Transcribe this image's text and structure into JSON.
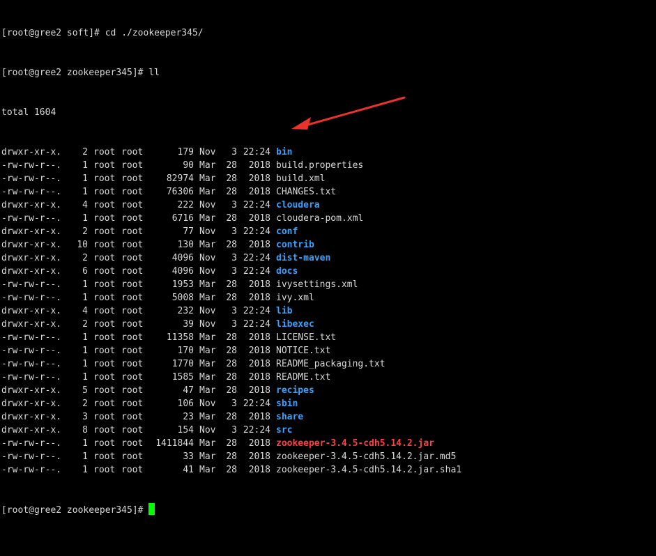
{
  "terminal": {
    "commands": [
      {
        "prompt": "[root@gree2 soft]# ",
        "command": "cd ./zookeeper345/"
      },
      {
        "prompt": "[root@gree2 zookeeper345]# ",
        "command": "ll"
      }
    ],
    "total": "total 1604",
    "entries": [
      {
        "perm": "drwxr-xr-x.",
        "links": "2",
        "owner": "root",
        "group": "root",
        "size": "179",
        "month": "Nov",
        "day": "3",
        "time": "22:24",
        "name": "bin",
        "kind": "dir"
      },
      {
        "perm": "-rw-rw-r--.",
        "links": "1",
        "owner": "root",
        "group": "root",
        "size": "90",
        "month": "Mar",
        "day": "28",
        "time": "2018",
        "name": "build.properties",
        "kind": "file"
      },
      {
        "perm": "-rw-rw-r--.",
        "links": "1",
        "owner": "root",
        "group": "root",
        "size": "82974",
        "month": "Mar",
        "day": "28",
        "time": "2018",
        "name": "build.xml",
        "kind": "file"
      },
      {
        "perm": "-rw-rw-r--.",
        "links": "1",
        "owner": "root",
        "group": "root",
        "size": "76306",
        "month": "Mar",
        "day": "28",
        "time": "2018",
        "name": "CHANGES.txt",
        "kind": "file"
      },
      {
        "perm": "drwxr-xr-x.",
        "links": "4",
        "owner": "root",
        "group": "root",
        "size": "222",
        "month": "Nov",
        "day": "3",
        "time": "22:24",
        "name": "cloudera",
        "kind": "dir"
      },
      {
        "perm": "-rw-rw-r--.",
        "links": "1",
        "owner": "root",
        "group": "root",
        "size": "6716",
        "month": "Mar",
        "day": "28",
        "time": "2018",
        "name": "cloudera-pom.xml",
        "kind": "file"
      },
      {
        "perm": "drwxr-xr-x.",
        "links": "2",
        "owner": "root",
        "group": "root",
        "size": "77",
        "month": "Nov",
        "day": "3",
        "time": "22:24",
        "name": "conf",
        "kind": "dir"
      },
      {
        "perm": "drwxr-xr-x.",
        "links": "10",
        "owner": "root",
        "group": "root",
        "size": "130",
        "month": "Mar",
        "day": "28",
        "time": "2018",
        "name": "contrib",
        "kind": "dir"
      },
      {
        "perm": "drwxr-xr-x.",
        "links": "2",
        "owner": "root",
        "group": "root",
        "size": "4096",
        "month": "Nov",
        "day": "3",
        "time": "22:24",
        "name": "dist-maven",
        "kind": "dir"
      },
      {
        "perm": "drwxr-xr-x.",
        "links": "6",
        "owner": "root",
        "group": "root",
        "size": "4096",
        "month": "Nov",
        "day": "3",
        "time": "22:24",
        "name": "docs",
        "kind": "dir"
      },
      {
        "perm": "-rw-rw-r--.",
        "links": "1",
        "owner": "root",
        "group": "root",
        "size": "1953",
        "month": "Mar",
        "day": "28",
        "time": "2018",
        "name": "ivysettings.xml",
        "kind": "file"
      },
      {
        "perm": "-rw-rw-r--.",
        "links": "1",
        "owner": "root",
        "group": "root",
        "size": "5008",
        "month": "Mar",
        "day": "28",
        "time": "2018",
        "name": "ivy.xml",
        "kind": "file"
      },
      {
        "perm": "drwxr-xr-x.",
        "links": "4",
        "owner": "root",
        "group": "root",
        "size": "232",
        "month": "Nov",
        "day": "3",
        "time": "22:24",
        "name": "lib",
        "kind": "dir"
      },
      {
        "perm": "drwxr-xr-x.",
        "links": "2",
        "owner": "root",
        "group": "root",
        "size": "39",
        "month": "Nov",
        "day": "3",
        "time": "22:24",
        "name": "libexec",
        "kind": "dir"
      },
      {
        "perm": "-rw-rw-r--.",
        "links": "1",
        "owner": "root",
        "group": "root",
        "size": "11358",
        "month": "Mar",
        "day": "28",
        "time": "2018",
        "name": "LICENSE.txt",
        "kind": "file"
      },
      {
        "perm": "-rw-rw-r--.",
        "links": "1",
        "owner": "root",
        "group": "root",
        "size": "170",
        "month": "Mar",
        "day": "28",
        "time": "2018",
        "name": "NOTICE.txt",
        "kind": "file"
      },
      {
        "perm": "-rw-rw-r--.",
        "links": "1",
        "owner": "root",
        "group": "root",
        "size": "1770",
        "month": "Mar",
        "day": "28",
        "time": "2018",
        "name": "README_packaging.txt",
        "kind": "file"
      },
      {
        "perm": "-rw-rw-r--.",
        "links": "1",
        "owner": "root",
        "group": "root",
        "size": "1585",
        "month": "Mar",
        "day": "28",
        "time": "2018",
        "name": "README.txt",
        "kind": "file"
      },
      {
        "perm": "drwxr-xr-x.",
        "links": "5",
        "owner": "root",
        "group": "root",
        "size": "47",
        "month": "Mar",
        "day": "28",
        "time": "2018",
        "name": "recipes",
        "kind": "dir"
      },
      {
        "perm": "drwxr-xr-x.",
        "links": "2",
        "owner": "root",
        "group": "root",
        "size": "106",
        "month": "Nov",
        "day": "3",
        "time": "22:24",
        "name": "sbin",
        "kind": "dir"
      },
      {
        "perm": "drwxr-xr-x.",
        "links": "3",
        "owner": "root",
        "group": "root",
        "size": "23",
        "month": "Mar",
        "day": "28",
        "time": "2018",
        "name": "share",
        "kind": "dir"
      },
      {
        "perm": "drwxr-xr-x.",
        "links": "8",
        "owner": "root",
        "group": "root",
        "size": "154",
        "month": "Nov",
        "day": "3",
        "time": "22:24",
        "name": "src",
        "kind": "dir"
      },
      {
        "perm": "-rw-rw-r--.",
        "links": "1",
        "owner": "root",
        "group": "root",
        "size": "1411844",
        "month": "Mar",
        "day": "28",
        "time": "2018",
        "name": "zookeeper-3.4.5-cdh5.14.2.jar",
        "kind": "jar"
      },
      {
        "perm": "-rw-rw-r--.",
        "links": "1",
        "owner": "root",
        "group": "root",
        "size": "33",
        "month": "Mar",
        "day": "28",
        "time": "2018",
        "name": "zookeeper-3.4.5-cdh5.14.2.jar.md5",
        "kind": "file"
      },
      {
        "perm": "-rw-rw-r--.",
        "links": "1",
        "owner": "root",
        "group": "root",
        "size": "41",
        "month": "Mar",
        "day": "28",
        "time": "2018",
        "name": "zookeeper-3.4.5-cdh5.14.2.jar.sha1",
        "kind": "file"
      }
    ],
    "final_prompt": "[root@gree2 zookeeper345]# ",
    "colors": {
      "background": "#000000",
      "text": "#d9d9d9",
      "directory": "#3aa0ff",
      "jar": "#ff4040",
      "cursor": "#00ff00",
      "annotation_arrow": "#e8322b"
    }
  }
}
